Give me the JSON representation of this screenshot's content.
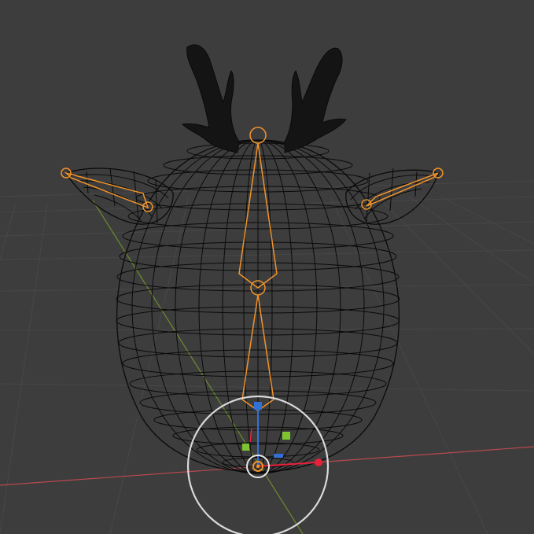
{
  "viewport": {
    "background": "#3d3d3d",
    "grid_color": "#474747",
    "x_axis_color": "#b8494f",
    "y_axis_color": "#6c8c2c",
    "wire_color": "#0a0a0a",
    "bone_color": "#f0932b",
    "gizmo_ring_color": "#d9d9d9",
    "gizmo_x_color": "#e8203a",
    "gizmo_y_color": "#7ec42f",
    "gizmo_z_color": "#3370d6"
  },
  "scene": {
    "objects": [
      "deer-head-mesh",
      "left-antler",
      "right-antler",
      "left-ear",
      "right-ear",
      "armature"
    ],
    "armature_bones": [
      "head-bone",
      "neck-bone",
      "ear-bone-left",
      "ear-bone-right"
    ],
    "active_tool": "transform-gizmo"
  }
}
